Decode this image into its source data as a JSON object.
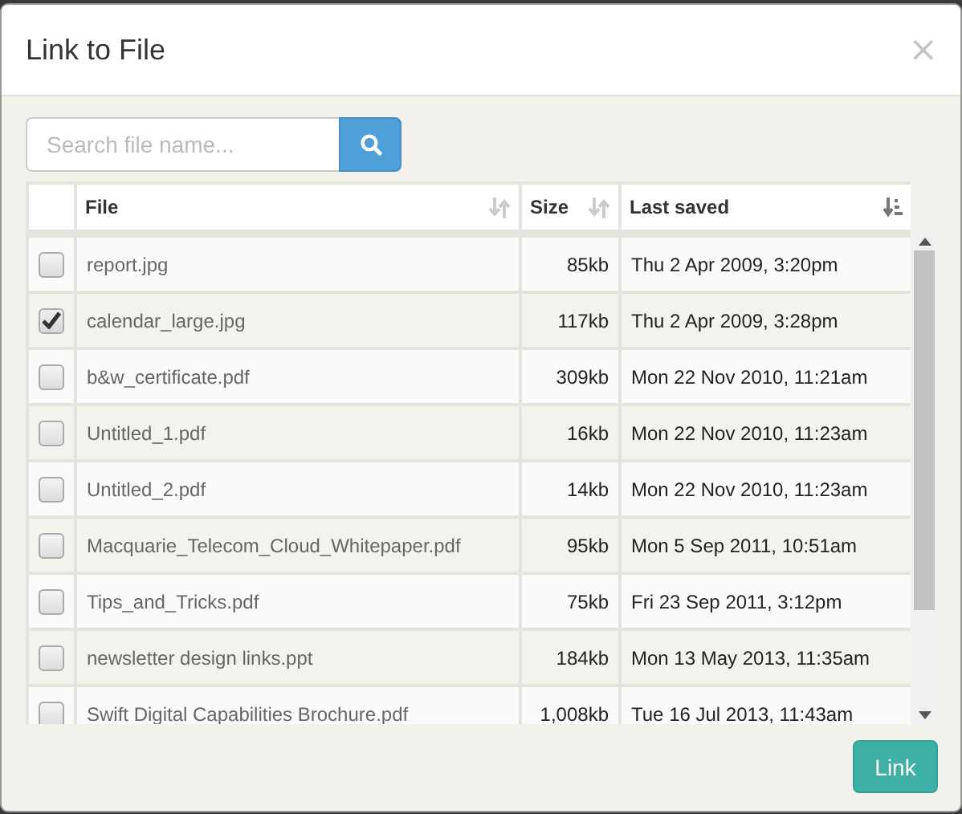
{
  "dialog": {
    "title": "Link to File",
    "close": "×"
  },
  "search": {
    "placeholder": "Search file name..."
  },
  "table": {
    "columns": [
      {
        "label": "File",
        "kind": "text",
        "sorted": false
      },
      {
        "label": "Size",
        "kind": "number",
        "sorted": false
      },
      {
        "label": "Last saved",
        "kind": "date",
        "sorted": true
      }
    ],
    "rows": [
      {
        "checked": false,
        "file": "report.jpg",
        "size": "85kb",
        "saved": "Thu 2 Apr 2009, 3:20pm"
      },
      {
        "checked": true,
        "file": "calendar_large.jpg",
        "size": "117kb",
        "saved": "Thu 2 Apr 2009, 3:28pm"
      },
      {
        "checked": false,
        "file": "b&w_certificate.pdf",
        "size": "309kb",
        "saved": "Mon 22 Nov 2010, 11:21am"
      },
      {
        "checked": false,
        "file": "Untitled_1.pdf",
        "size": "16kb",
        "saved": "Mon 22 Nov 2010, 11:23am"
      },
      {
        "checked": false,
        "file": "Untitled_2.pdf",
        "size": "14kb",
        "saved": "Mon 22 Nov 2010, 11:23am"
      },
      {
        "checked": false,
        "file": "Macquarie_Telecom_Cloud_Whitepaper.pdf",
        "size": "95kb",
        "saved": "Mon 5 Sep 2011, 10:51am"
      },
      {
        "checked": false,
        "file": "Tips_and_Tricks.pdf",
        "size": "75kb",
        "saved": "Fri 23 Sep 2011, 3:12pm"
      },
      {
        "checked": false,
        "file": "newsletter design links.ppt",
        "size": "184kb",
        "saved": "Mon 13 May 2013, 11:35am"
      },
      {
        "checked": false,
        "file": "Swift Digital Capabilities Brochure.pdf",
        "size": "1,008kb",
        "saved": "Tue 16 Jul 2013, 11:43am"
      }
    ]
  },
  "buttons": [
    {
      "label": "Link"
    }
  ]
}
